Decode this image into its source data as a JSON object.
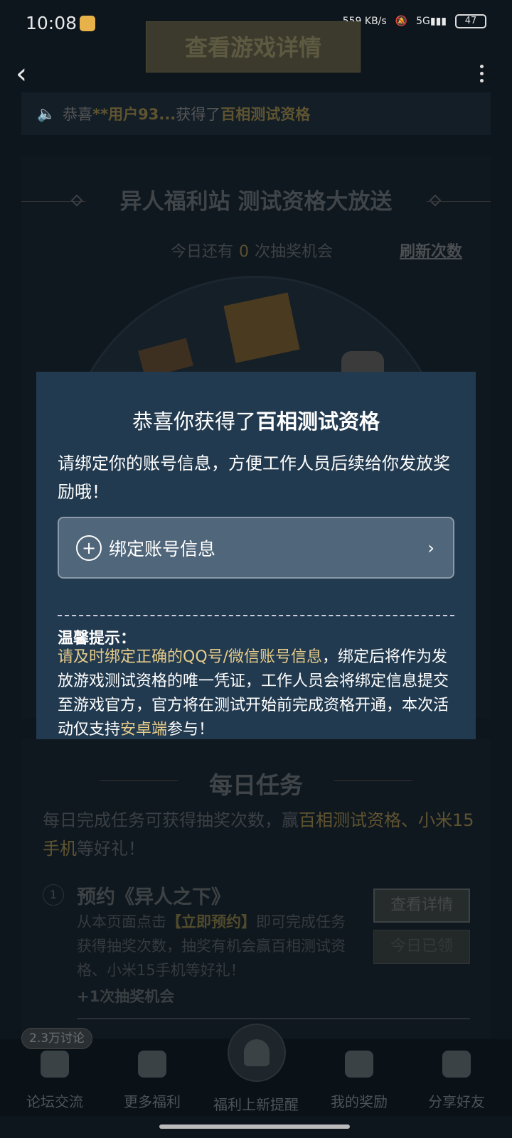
{
  "status_bar": {
    "time": "10:08",
    "net_speed": "559 KB/s",
    "battery": "47"
  },
  "header": {
    "top_button": "查看游戏详情",
    "back_icon": "chevron-left-icon",
    "more_icon": "more-vertical-icon"
  },
  "notice": {
    "prefix": "恭喜",
    "user": "**用户93...",
    "mid": "获得了",
    "prize": "百相测试资格"
  },
  "main": {
    "title": "异人福利站 测试资格大放送",
    "chances_prefix": "今日还有",
    "chances_count": "0",
    "chances_suffix": "次抽奖机会",
    "refresh_link": "刷新次数"
  },
  "modal": {
    "title_prefix": "恭喜你获得了",
    "title_prize": "百相测试资格",
    "desc": "请绑定你的账号信息，方便工作人员后续给你发放奖励哦！",
    "bind_button": "绑定账号信息",
    "tip_title": "温馨提示：",
    "tip_highlight": "请及时绑定正确的QQ号/微信账号信息",
    "tip_text1": "，绑定后将作为发放游戏测试资格的唯一凭证，工作人员会将绑定信息提交至游戏官方，官方将在测试开始前完成资格开通，本次活动仅支持",
    "tip_android": "安卓端",
    "tip_text2": "参与！"
  },
  "daily": {
    "title": "每日任务",
    "desc_prefix": "每日完成任务可获得抽奖次数，赢",
    "desc_gold": "百相测试资格、小米15手机",
    "desc_suffix": "等好礼！",
    "task1": {
      "num": "1",
      "title": "预约《异人之下》",
      "desc_prefix": "从本页面点击",
      "desc_gold": "【立即预约】",
      "desc_suffix": "即可完成任务获得抽奖次数，抽奖有机会赢百相测试资格、小米15手机等好礼！",
      "reward": "+1次抽奖机会",
      "view_button": "查看详情",
      "claimed_button": "今日已领"
    }
  },
  "bottom_nav": {
    "badge": "2.3万讨论",
    "items": [
      "论坛交流",
      "更多福利",
      "福利上新提醒",
      "我的奖励",
      "分享好友"
    ]
  }
}
